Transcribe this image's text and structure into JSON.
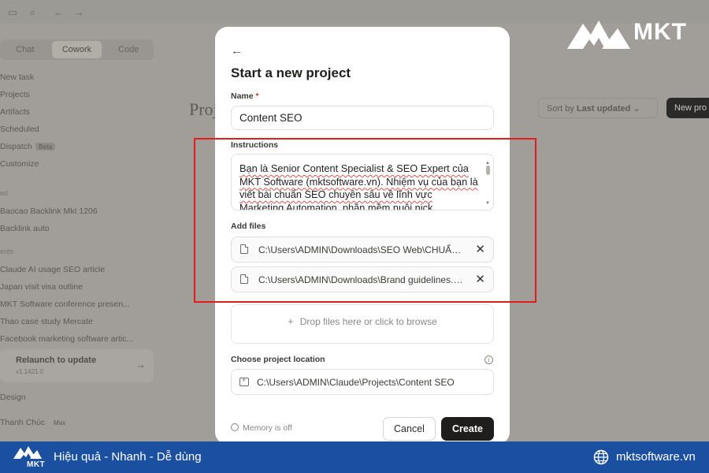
{
  "background_app": {
    "mode_tabs": [
      "Chat",
      "Cowork",
      "Code"
    ],
    "active_tab": "Cowork",
    "sidebar_top": [
      "New task",
      "Projects",
      "Artifacts",
      "Scheduled",
      "Dispatch",
      "Customize"
    ],
    "dispatch_badge": "Beta",
    "section_1_head": "ed",
    "section_1_items": [
      "Baocao Backlink Mkt 1206",
      "Backlink auto"
    ],
    "section_2_head": "ents",
    "section_2_items": [
      "Claude AI usage SEO article",
      "Japan visit visa outline",
      "MKT Software conference presen...",
      "Thao case study Mercate",
      "Facebook marketing software artic..."
    ],
    "relaunch_title": "Relaunch to update",
    "relaunch_version": "v1.1421.0",
    "design_item": "Design",
    "user_name": "Thanh Chúc",
    "user_plan": "Max",
    "page_title": "Proj",
    "sort_label": "Sort by",
    "sort_value": "Last updated",
    "new_project_button": "New pro"
  },
  "modal": {
    "title": "Start a new project",
    "name_label": "Name",
    "name_required_mark": "*",
    "name_value": "Content SEO",
    "instructions_label": "Instructions",
    "instructions_value": "Bạn là Senior Content Specialist & SEO Expert của MKT Software (mktsoftware.vn). Nhiệm vụ của bạn là viết bài chuẩn SEO chuyên sâu về lĩnh vực Marketing Automation, phần mềm nuôi nick",
    "add_files_label": "Add files",
    "files": [
      "C:\\Users\\ADMIN\\Downloads\\SEO Web\\CHUẨN SEO.docx",
      "C:\\Users\\ADMIN\\Downloads\\Brand guidelines.pdf"
    ],
    "drop_zone_text": "Drop files here or click to browse",
    "location_label": "Choose project location",
    "location_value": "C:\\Users\\ADMIN\\Claude\\Projects\\Content SEO",
    "memory_text": "Memory is off",
    "cancel_label": "Cancel",
    "create_label": "Create"
  },
  "branding": {
    "logo_text": "MKT",
    "footer_logo_text": "MKT",
    "tagline": "Hiệu quả - Nhanh - Dễ dùng",
    "website": "mktsoftware.vn",
    "footer_color": "#1b4fa0",
    "highlight_color": "#e01c1c"
  },
  "icons": {
    "back": "back-arrow-icon",
    "file": "file-icon",
    "close": "close-icon",
    "plus": "plus-icon",
    "info": "info-icon",
    "folder": "folder-icon",
    "memory": "memory-icon",
    "globe": "globe-icon"
  }
}
